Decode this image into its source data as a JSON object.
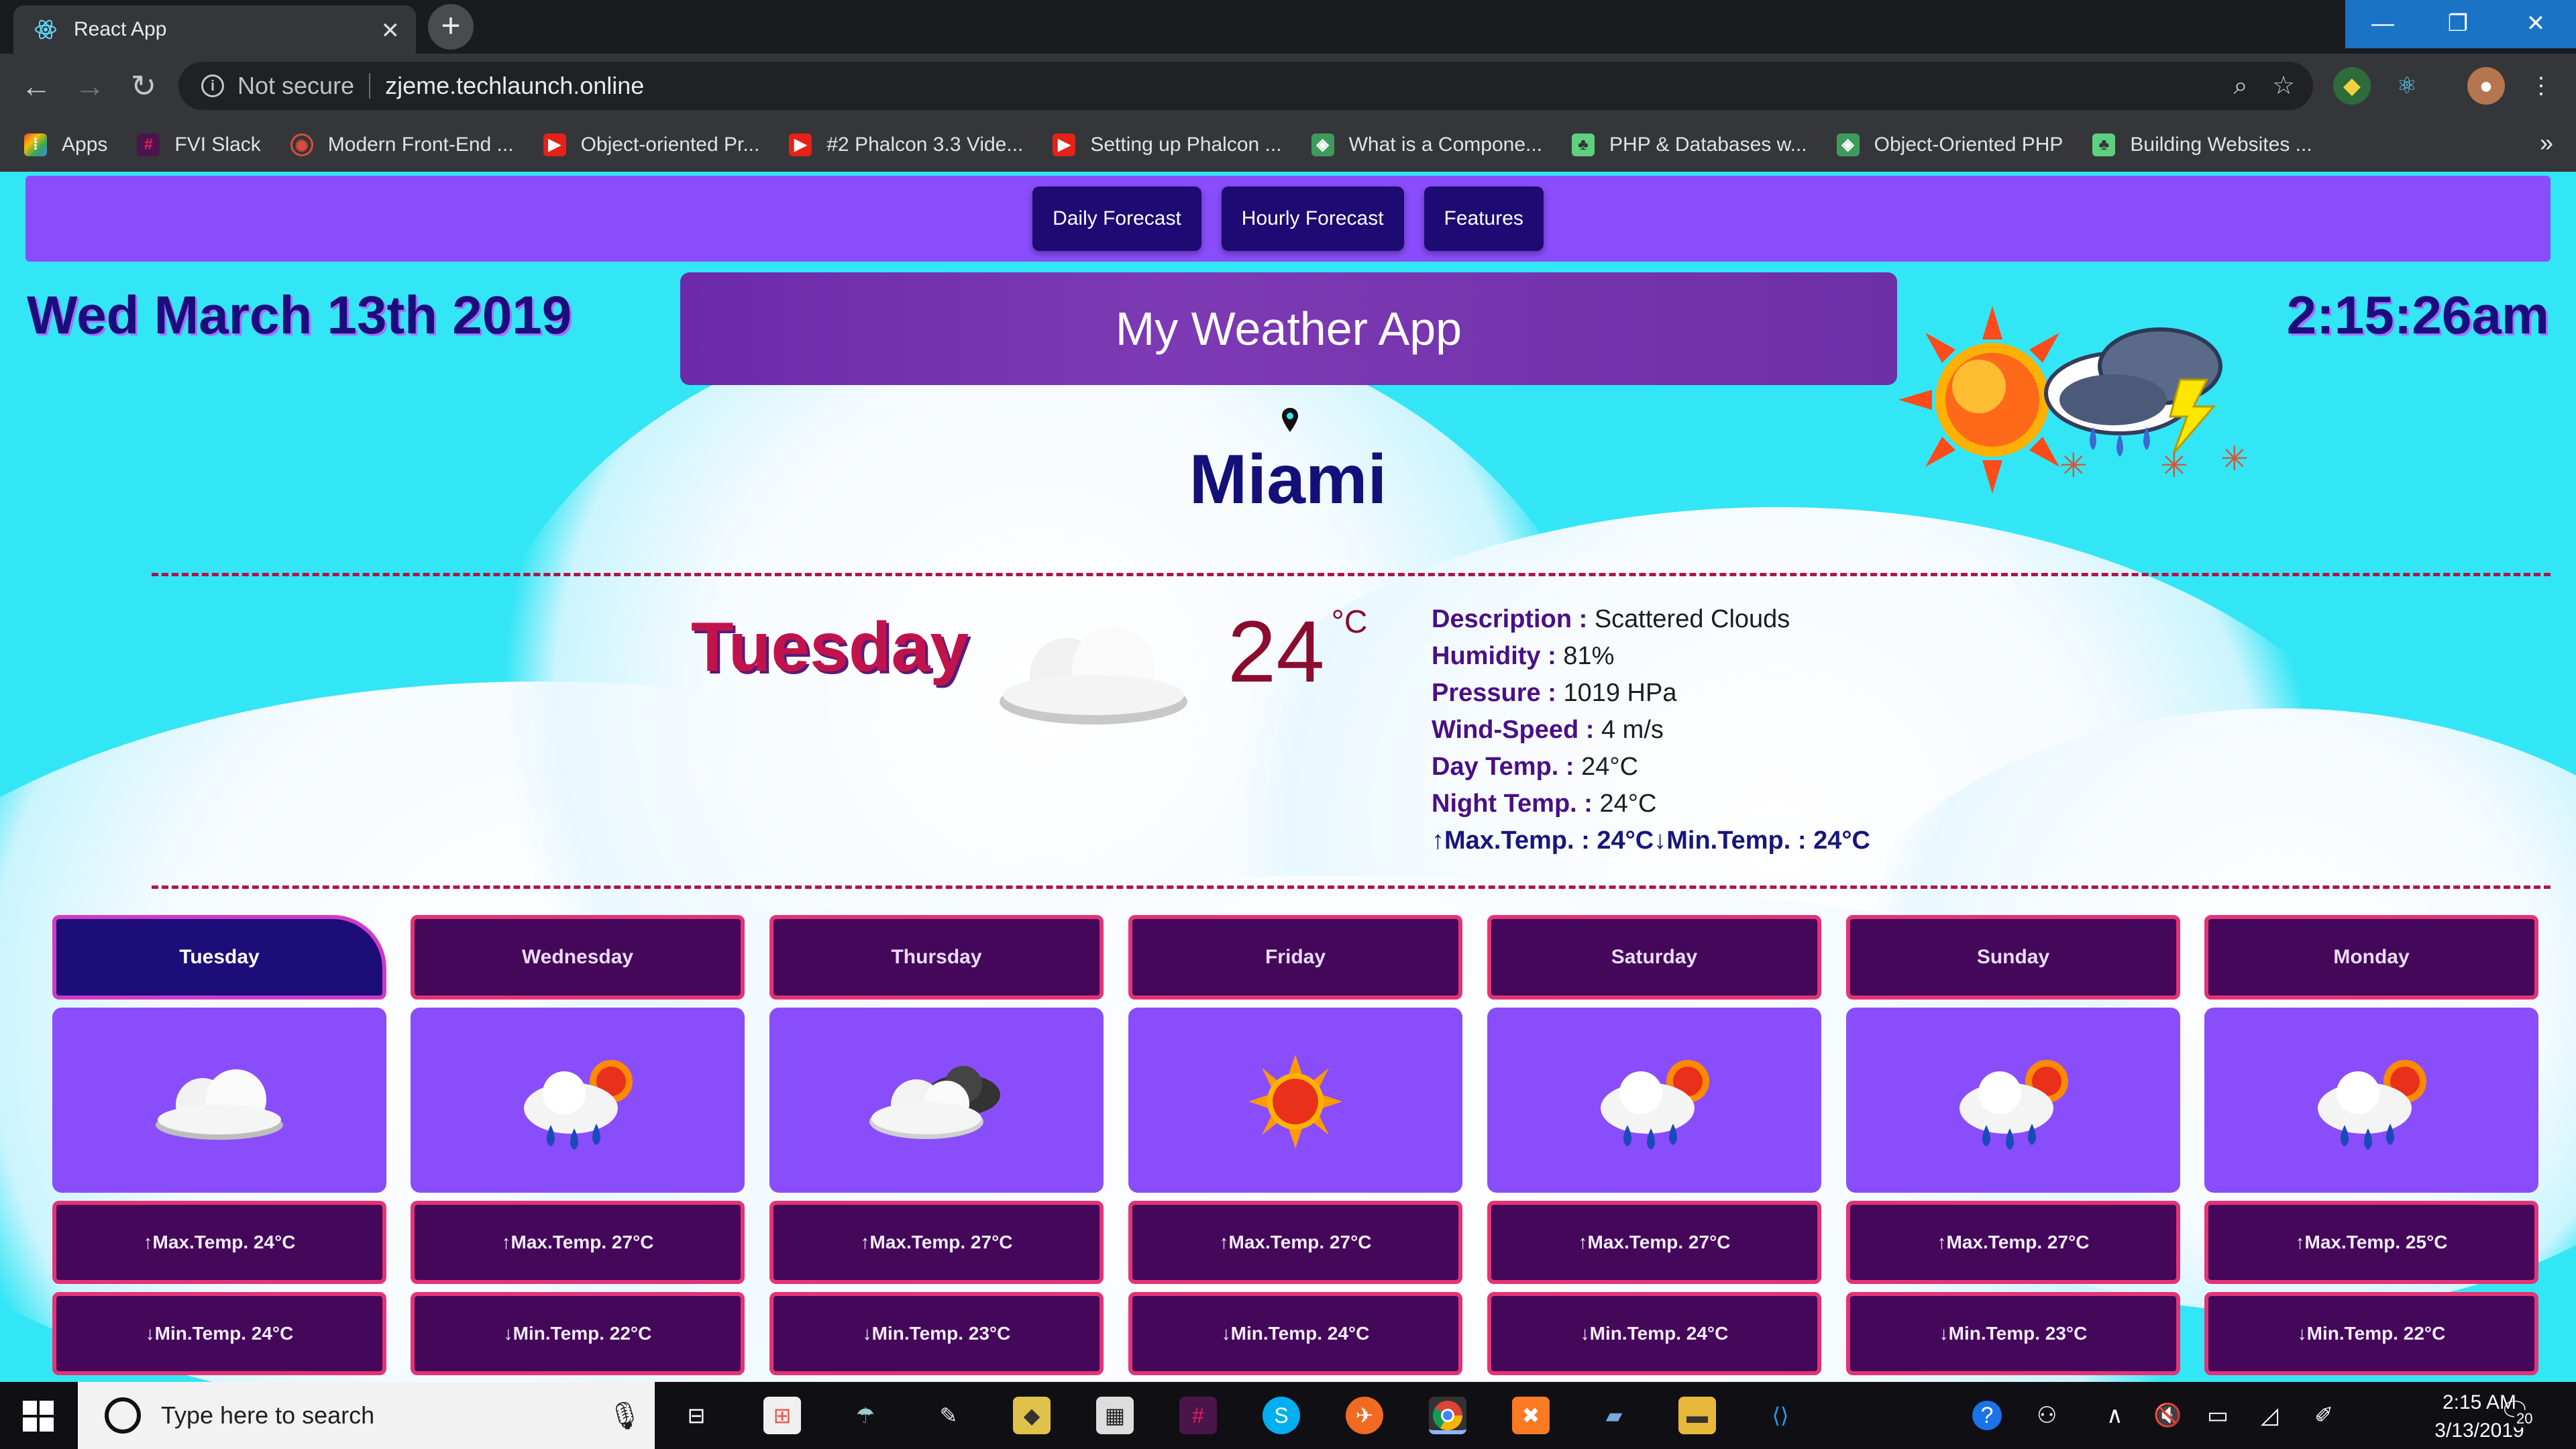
{
  "browser": {
    "tab_title": "React App",
    "security_label": "Not secure",
    "url": "zjeme.techlaunch.online",
    "bookmarks": [
      {
        "label": "Apps",
        "icon": "apps-grid-icon"
      },
      {
        "label": "FVI Slack",
        "icon": "slack-icon"
      },
      {
        "label": "Modern Front-End ...",
        "icon": "frontend-icon"
      },
      {
        "label": "Object-oriented Pr...",
        "icon": "youtube-icon"
      },
      {
        "label": "#2 Phalcon 3.3 Vide...",
        "icon": "youtube-icon"
      },
      {
        "label": "Setting up Phalcon ...",
        "icon": "youtube-icon"
      },
      {
        "label": "What is a Compone...",
        "icon": "vue-icon"
      },
      {
        "label": "PHP & Databases w...",
        "icon": "treehouse-icon"
      },
      {
        "label": "Object-Oriented PHP",
        "icon": "vue-icon"
      },
      {
        "label": "Building Websites ...",
        "icon": "treehouse-icon"
      }
    ],
    "more_bookmarks": "»"
  },
  "nav": {
    "buttons": [
      "Daily Forecast",
      "Hourly Forecast",
      "Features"
    ]
  },
  "header": {
    "date": "Wed March 13th 2019",
    "time": "2:15:26am",
    "app_title": "My Weather App",
    "city": "Miami"
  },
  "current": {
    "day": "Tuesday",
    "temperature": "24",
    "unit": "°C",
    "details": [
      {
        "label": "Description :",
        "value": "Scattered Clouds"
      },
      {
        "label": "Humidity :",
        "value": "81%"
      },
      {
        "label": "Pressure :",
        "value": "1019 HPa"
      },
      {
        "label": "Wind-Speed :",
        "value": "4 m/s"
      },
      {
        "label": "Day Temp. :",
        "value": "24°C"
      },
      {
        "label": "Night Temp. :",
        "value": "24°C"
      }
    ],
    "max_min_line": "↑Max.Temp. : 24°C↓Min.Temp. : 24°C"
  },
  "forecast": [
    {
      "day": "Tuesday",
      "icon": "cloud-icon",
      "max": "↑Max.Temp. 24°C",
      "min": "↓Min.Temp. 24°C",
      "active": true
    },
    {
      "day": "Wednesday",
      "icon": "sun-rain-cloud-icon",
      "max": "↑Max.Temp. 27°C",
      "min": "↓Min.Temp. 22°C"
    },
    {
      "day": "Thursday",
      "icon": "dark-clouds-icon",
      "max": "↑Max.Temp. 27°C",
      "min": "↓Min.Temp. 23°C"
    },
    {
      "day": "Friday",
      "icon": "sun-icon",
      "max": "↑Max.Temp. 27°C",
      "min": "↓Min.Temp. 24°C"
    },
    {
      "day": "Saturday",
      "icon": "sun-rain-cloud-icon",
      "max": "↑Max.Temp. 27°C",
      "min": "↓Min.Temp. 24°C"
    },
    {
      "day": "Sunday",
      "icon": "sun-rain-cloud-icon",
      "max": "↑Max.Temp. 27°C",
      "min": "↓Min.Temp. 23°C"
    },
    {
      "day": "Monday",
      "icon": "sun-rain-cloud-icon",
      "max": "↑Max.Temp. 25°C",
      "min": "↓Min.Temp. 22°C"
    }
  ],
  "taskbar": {
    "search_placeholder": "Type here to search",
    "time": "2:15 AM",
    "date": "3/13/2019",
    "notification_count": "20"
  }
}
